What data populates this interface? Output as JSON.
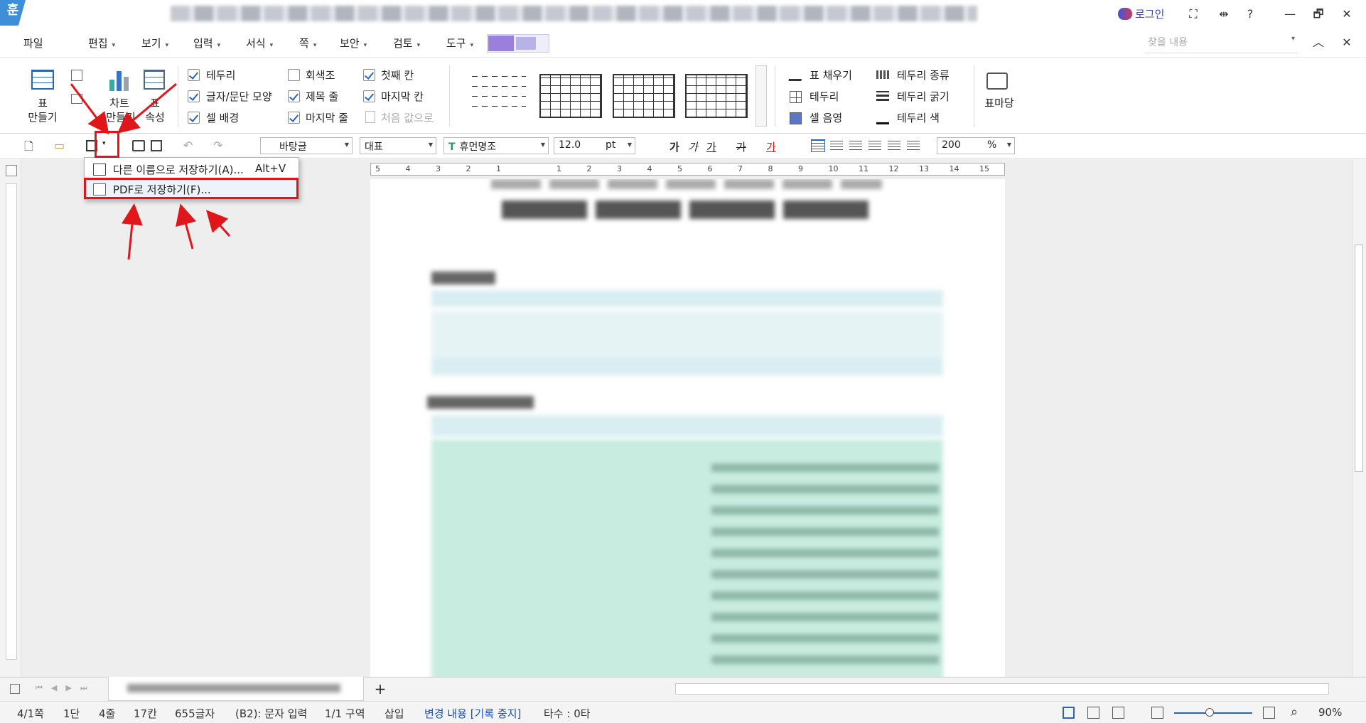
{
  "app": {
    "logo_glyph": "훈",
    "login_label": "로그인"
  },
  "window_controls": {
    "fullscreen": "⛶",
    "split": "⇹",
    "help": "?",
    "minimize": "—",
    "restore": "🗗",
    "close": "✕"
  },
  "menubar": {
    "items": [
      {
        "label": "파일",
        "has_arrow": false
      },
      {
        "label": "편집",
        "has_arrow": true
      },
      {
        "label": "보기",
        "has_arrow": true
      },
      {
        "label": "입력",
        "has_arrow": true
      },
      {
        "label": "서식",
        "has_arrow": true
      },
      {
        "label": "쪽",
        "has_arrow": true
      },
      {
        "label": "보안",
        "has_arrow": true
      },
      {
        "label": "검토",
        "has_arrow": true
      },
      {
        "label": "도구",
        "has_arrow": true
      }
    ],
    "arrow_glyph": "▾",
    "search_placeholder": "찾을 내용"
  },
  "ribbon": {
    "table_create": {
      "line1": "표",
      "line2": "만들기"
    },
    "chart_create": {
      "line1": "차트",
      "line2": "만들기"
    },
    "table_props": {
      "line1": "표",
      "line2": "속성"
    },
    "checkboxes": [
      {
        "label": "테두리",
        "checked": true
      },
      {
        "label": "글자/문단 모양",
        "checked": true
      },
      {
        "label": "셀 배경",
        "checked": true
      },
      {
        "label": "회색조",
        "checked": false
      },
      {
        "label": "제목 줄",
        "checked": true
      },
      {
        "label": "마지막 줄",
        "checked": true
      },
      {
        "label": "첫째 칸",
        "checked": true
      },
      {
        "label": "마지막 칸",
        "checked": true
      }
    ],
    "reset_label": "처음 값으로",
    "fill_label": "표 채우기",
    "border_label": "테두리",
    "cell_shade_label": "셀 음영",
    "border_type_label": "테두리 종류",
    "border_thickness_label": "테두리 굵기",
    "border_color_label": "테두리 색",
    "table_template_label": "표마당"
  },
  "toolbar": {
    "style_value": "바탕글",
    "font_lang_value": "대표",
    "font_value": "휴먼명조",
    "font_size_value": "12.0",
    "font_unit": "pt",
    "zoom_value": "200",
    "zoom_unit": "%",
    "bold_glyph": "가",
    "italic_glyph": "가",
    "underline_glyph": "가",
    "strike_glyph": "가",
    "color_glyph": "가"
  },
  "dropdown": {
    "save_as_label": "다른 이름으로 저장하기(A)...",
    "save_as_shortcut": "Alt+V",
    "save_pdf_label": "PDF로 저장하기(F)..."
  },
  "ruler": {
    "ticks": [
      "5",
      "4",
      "3",
      "2",
      "1",
      "",
      "1",
      "2",
      "3",
      "4",
      "5",
      "6",
      "7",
      "8",
      "9",
      "10",
      "11",
      "12",
      "13",
      "14",
      "15"
    ]
  },
  "statusbar": {
    "page": "4/1쪽",
    "column": "1단",
    "line": "4줄",
    "col_pos": "17칸",
    "chars": "655글자",
    "mode": "(B2): 문자 입력",
    "section": "1/1 구역",
    "insert": "삽입",
    "track": "변경 내용 [기록 중지]",
    "typing": "타수 : 0타",
    "zoom": "90%"
  },
  "doc_tab": {
    "add_glyph": "+"
  },
  "colors": {
    "accent": "#3f8fd8",
    "annotation_red": "#e0161b",
    "table_header": "#d9eef2",
    "table_green": "#c9ece0",
    "track_text": "#1a4fb5"
  }
}
